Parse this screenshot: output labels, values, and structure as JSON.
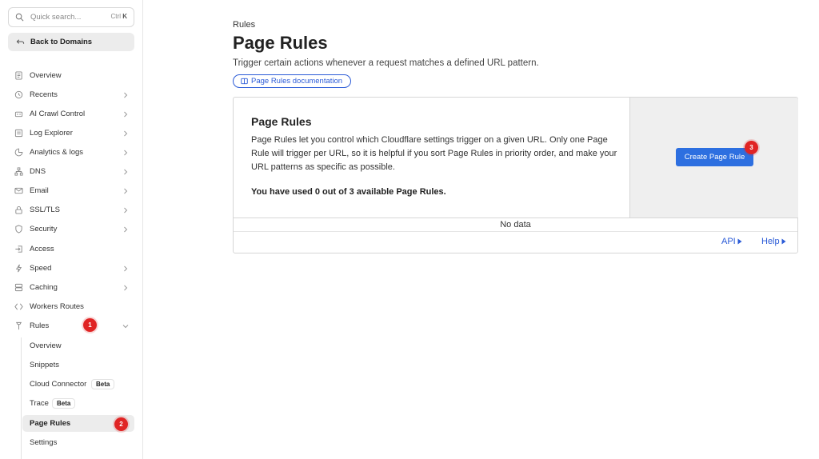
{
  "search": {
    "placeholder": "Quick search...",
    "shortcut_prefix": "Ctrl",
    "shortcut_key": "K"
  },
  "back_button": {
    "label": "Back to Domains"
  },
  "nav": {
    "items": [
      {
        "label": "Overview",
        "icon": "document-icon",
        "chevron": false
      },
      {
        "label": "Recents",
        "icon": "clock-icon",
        "chevron": true
      },
      {
        "label": "AI Crawl Control",
        "icon": "bot-icon",
        "chevron": true
      },
      {
        "label": "Log Explorer",
        "icon": "log-icon",
        "chevron": true
      },
      {
        "label": "Analytics & logs",
        "icon": "chart-icon",
        "chevron": true
      },
      {
        "label": "DNS",
        "icon": "network-icon",
        "chevron": true
      },
      {
        "label": "Email",
        "icon": "email-icon",
        "chevron": true
      },
      {
        "label": "SSL/TLS",
        "icon": "lock-icon",
        "chevron": true
      },
      {
        "label": "Security",
        "icon": "shield-icon",
        "chevron": true
      },
      {
        "label": "Access",
        "icon": "access-icon",
        "chevron": false
      },
      {
        "label": "Speed",
        "icon": "bolt-icon",
        "chevron": true
      },
      {
        "label": "Caching",
        "icon": "server-icon",
        "chevron": true
      },
      {
        "label": "Workers Routes",
        "icon": "workers-icon",
        "chevron": false
      },
      {
        "label": "Rules",
        "icon": "rules-icon",
        "chevron": false
      }
    ],
    "rules_sub": [
      {
        "label": "Overview"
      },
      {
        "label": "Snippets"
      },
      {
        "label": "Cloud Connector",
        "badge": "Beta"
      },
      {
        "label": "Trace",
        "badge": "Beta"
      },
      {
        "label": "Page Rules",
        "active": true
      },
      {
        "label": "Settings"
      }
    ]
  },
  "markers": {
    "m1": "1",
    "m2": "2",
    "m3": "3"
  },
  "main": {
    "breadcrumb": "Rules",
    "title": "Page Rules",
    "subtitle": "Trigger certain actions whenever a request matches a defined URL pattern.",
    "doc_link": "Page Rules documentation"
  },
  "card": {
    "title": "Page Rules",
    "description": "Page Rules let you control which Cloudflare settings trigger on a given URL. Only one Page Rule will trigger per URL, so it is helpful if you sort Page Rules in priority order, and make your URL patterns as specific as possible.",
    "usage": "You have used 0 out of 3 available Page Rules.",
    "create_button": "Create Page Rule",
    "empty_text": "No data",
    "api_link": "API",
    "help_link": "Help"
  },
  "colors": {
    "accent": "#2d6fe0",
    "marker": "#e02424",
    "link": "#2b5bd7"
  }
}
